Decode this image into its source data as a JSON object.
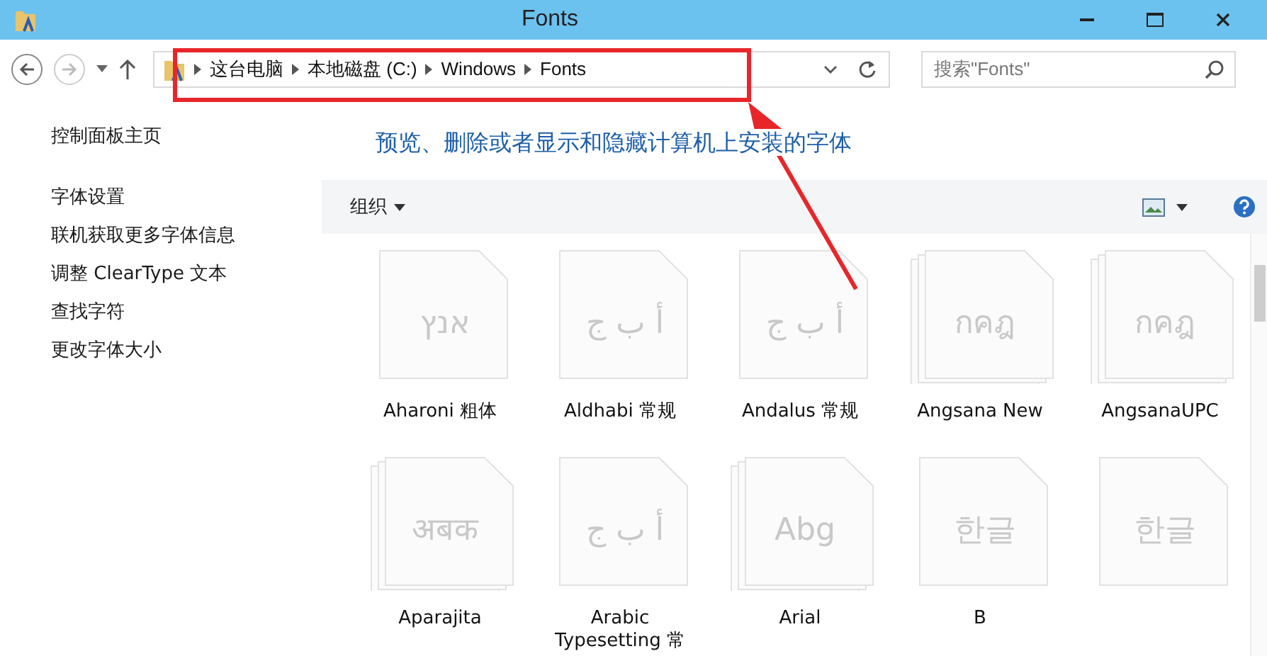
{
  "window": {
    "title": "Fonts"
  },
  "address_bar": {
    "crumbs": [
      "这台电脑",
      "本地磁盘 (C:)",
      "Windows",
      "Fonts"
    ]
  },
  "search": {
    "placeholder": "搜索\"Fonts\""
  },
  "sidebar": {
    "items": [
      {
        "label": "控制面板主页",
        "kind": "home"
      },
      {
        "label": "字体设置",
        "kind": "link"
      },
      {
        "label": "联机获取更多字体信息",
        "kind": "link"
      },
      {
        "label": "调整 ClearType 文本",
        "kind": "link"
      },
      {
        "label": "查找字符",
        "kind": "link"
      },
      {
        "label": "更改字体大小",
        "kind": "link"
      }
    ]
  },
  "heading": "预览、删除或者显示和隐藏计算机上安装的字体",
  "command_bar": {
    "organize": "组织"
  },
  "fonts": [
    {
      "name": "Aharoni 粗体",
      "sample": "אנץ",
      "kind": "single"
    },
    {
      "name": "Aldhabi 常规",
      "sample": "أ ب ج",
      "kind": "single"
    },
    {
      "name": "Andalus 常规",
      "sample": "أ ب ج",
      "kind": "single"
    },
    {
      "name": "Angsana New",
      "sample": "กคฎ",
      "kind": "stack"
    },
    {
      "name": "AngsanaUPC",
      "sample": "กคฎ",
      "kind": "stack"
    },
    {
      "name": "Aparajita",
      "sample": "अबक",
      "kind": "stack"
    },
    {
      "name": "Arabic Typesetting 常",
      "sample": "أ ب ج",
      "kind": "single"
    },
    {
      "name": "Arial",
      "sample": "Abg",
      "kind": "stack"
    },
    {
      "name": "B",
      "sample": "한글",
      "kind": "single"
    },
    {
      "sample": "한글",
      "kind": "single"
    }
  ]
}
